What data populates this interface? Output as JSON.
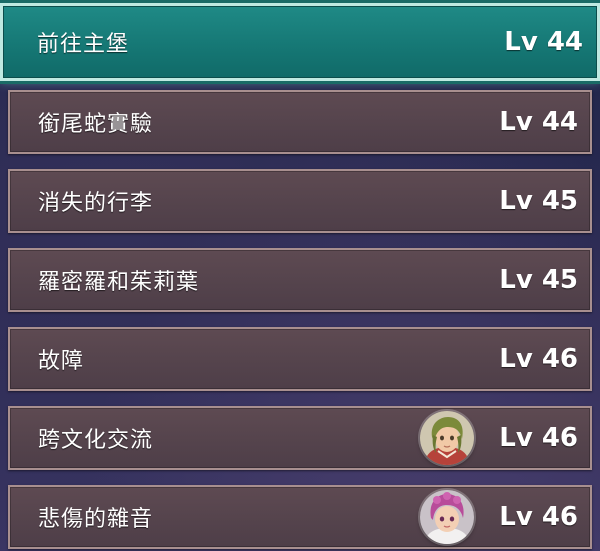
{
  "quests": [
    {
      "name": "前往主堡",
      "level": "Lv 44",
      "selected": true,
      "avatar": null
    },
    {
      "name": "銜尾蛇實驗",
      "level": "Lv 44",
      "selected": false,
      "avatar": null
    },
    {
      "name": "消失的行李",
      "level": "Lv 45",
      "selected": false,
      "avatar": null
    },
    {
      "name": "羅密羅和茱莉葉",
      "level": "Lv 45",
      "selected": false,
      "avatar": null
    },
    {
      "name": "故障",
      "level": "Lv 46",
      "selected": false,
      "avatar": null
    },
    {
      "name": "跨文化交流",
      "level": "Lv 46",
      "selected": false,
      "avatar": "character-avatar-green-hair"
    },
    {
      "name": "悲傷的雜音",
      "level": "Lv 46",
      "selected": false,
      "avatar": "character-avatar-pink-hair"
    }
  ],
  "colors": {
    "selected_fill": "#167875",
    "selected_border": "#bfe9e1",
    "row_fill": "#54434c",
    "row_border": "#a88f8f",
    "text": "#ffffff"
  }
}
